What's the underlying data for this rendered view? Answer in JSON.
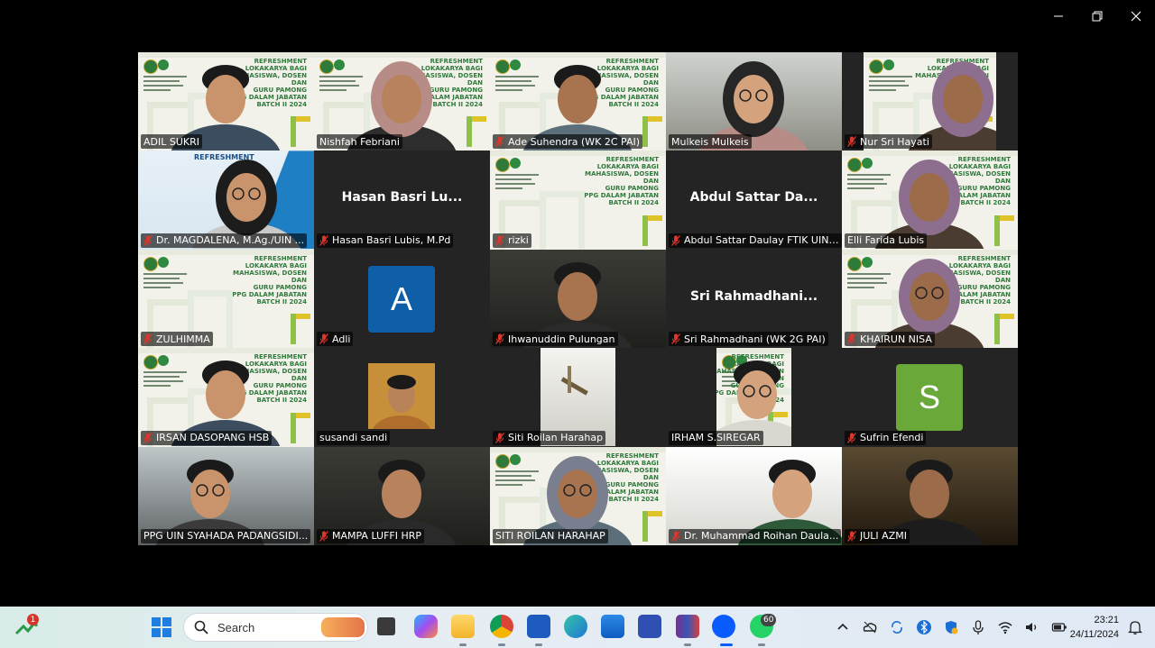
{
  "window": {
    "minimize_label": "",
    "maximize_label": "",
    "close_label": ""
  },
  "gallery": {
    "tiles": [
      {
        "name": "ADIL SUKRI",
        "muted": false,
        "active": true,
        "video": "slide-person"
      },
      {
        "name": "Nishfah Febriani",
        "muted": false,
        "video": "slide-person"
      },
      {
        "name": "Ade Suhendra (WK 2C PAI)",
        "muted": true,
        "video": "slide-person"
      },
      {
        "name": "Mulkeis Mulkeis",
        "muted": false,
        "video": "room-person"
      },
      {
        "name": "Nur Sri Hayati",
        "muted": true,
        "video": "slide-person-inset"
      },
      {
        "name": "Dr. MAGDALENA, M.Ag./UIN ...",
        "muted": true,
        "video": "blue-slide-person",
        "slide_word": "REFRESHMENT"
      },
      {
        "name": "Hasan Basri  Lubis, M.Pd",
        "muted": true,
        "display_name": "Hasan Basri  Lu...",
        "video": "none"
      },
      {
        "name": "rizki",
        "muted": true,
        "video": "slide"
      },
      {
        "name": "Abdul Sattar Daulay FTIK UIN ...",
        "muted": true,
        "display_name": "Abdul  Sattar  Da...",
        "video": "none"
      },
      {
        "name": "Elli Farida Lubis",
        "muted": false,
        "video": "slide-person"
      },
      {
        "name": "ZULHIMMA",
        "muted": true,
        "video": "slide"
      },
      {
        "name": "Adli",
        "muted": true,
        "video": "avatar",
        "avatar_letter": "A",
        "avatar_color": "#0f5fa8"
      },
      {
        "name": "Ihwanuddin Pulungan",
        "muted": true,
        "video": "dark-person"
      },
      {
        "name": "Sri Rahmadhani (WK 2G PAI)",
        "muted": true,
        "display_name": "Sri  Rahmadhani...",
        "video": "none"
      },
      {
        "name": "KHAIRUN NISA",
        "muted": true,
        "video": "slide-person"
      },
      {
        "name": "IRSAN DASOPANG HSB",
        "muted": true,
        "video": "slide-person"
      },
      {
        "name": "susandi sandi",
        "muted": false,
        "video": "small-inset"
      },
      {
        "name": "Siti Roilan Harahap",
        "muted": true,
        "video": "white-inset"
      },
      {
        "name": "IRHAM S.SIREGAR",
        "muted": false,
        "video": "slide-inset"
      },
      {
        "name": "Sufrin Efendi",
        "muted": true,
        "video": "avatar",
        "avatar_letter": "S",
        "avatar_color": "#6aa83a"
      },
      {
        "name": "PPG UIN SYAHADA PADANGSIDI...",
        "muted": false,
        "video": "window-person"
      },
      {
        "name": "MAMPA LUFFI HRP",
        "muted": true,
        "video": "dark-person"
      },
      {
        "name": "SITI ROILAN HARAHAP",
        "muted": false,
        "video": "slide-person"
      },
      {
        "name": "Dr. Muhammad Roihan Daula...",
        "muted": true,
        "video": "white-person"
      },
      {
        "name": "JULI AZMI",
        "muted": true,
        "video": "gold-person"
      }
    ],
    "slide_title_lines": [
      "REFRESHMENT",
      "LOKAKARYA BAGI",
      "MAHASISWA, DOSEN DAN",
      "GURU PAMONG",
      "PPG DALAM JABATAN",
      "BATCH II 2024"
    ]
  },
  "taskbar": {
    "weather_badge": "1",
    "search_placeholder": "Search",
    "whatsapp_badge": "60",
    "time": "23:21",
    "date": "24/11/2024",
    "apps": [
      "task-view",
      "copilot",
      "file-explorer",
      "chrome",
      "word",
      "edge",
      "microsoft-store",
      "snipping-tool",
      "winrar",
      "zoom",
      "whatsapp"
    ]
  },
  "colors": {
    "active_speaker": "#2ecc71",
    "muted_icon": "#e0352b",
    "zoom_blue": "#0b5cff",
    "whatsapp_green": "#25d366"
  }
}
